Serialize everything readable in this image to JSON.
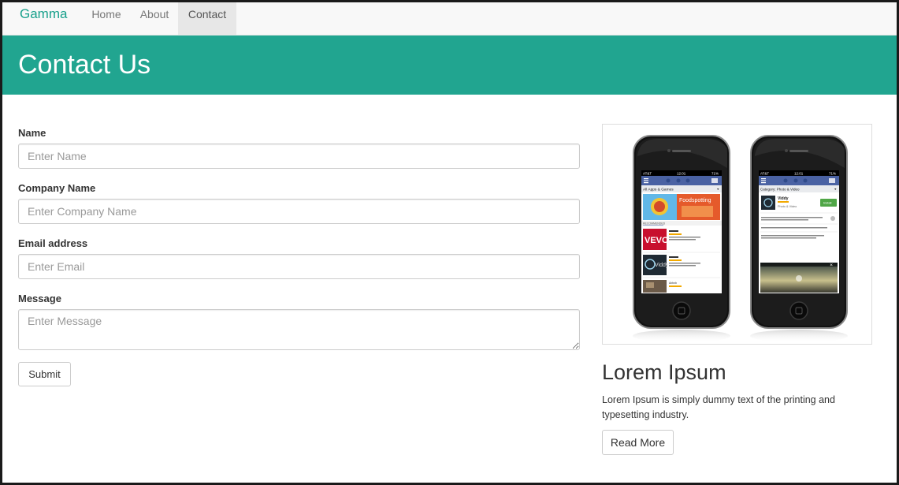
{
  "navbar": {
    "brand": "Gamma",
    "items": [
      {
        "label": "Home",
        "active": false
      },
      {
        "label": "About",
        "active": false
      },
      {
        "label": "Contact",
        "active": true
      }
    ]
  },
  "header": {
    "title": "Contact Us"
  },
  "form": {
    "name": {
      "label": "Name",
      "placeholder": "Enter Name",
      "value": ""
    },
    "company": {
      "label": "Company Name",
      "placeholder": "Enter Company Name",
      "value": ""
    },
    "email": {
      "label": "Email address",
      "placeholder": "Enter Email",
      "value": ""
    },
    "message": {
      "label": "Message",
      "placeholder": "Enter Message",
      "value": ""
    },
    "submit_label": "Submit"
  },
  "side": {
    "image": {
      "left_phone": {
        "carrier": "AT&T",
        "time": "12:01",
        "battery": "71%",
        "category": "All Apps & Games",
        "banner": "Foodspotting",
        "tab": "RECOMMENDED",
        "apps": [
          "VEVO",
          "Viddy",
          "Airbnb"
        ]
      },
      "right_phone": {
        "carrier": "AT&T",
        "time": "12:01",
        "battery": "71%",
        "category": "Category: Photo & Video",
        "app_name": "Viddy",
        "app_sub": "Photo & Video",
        "install_label": "Install"
      }
    },
    "title": "Lorem Ipsum",
    "text": "Lorem Ipsum is simply dummy text of the printing and typesetting industry.",
    "button_label": "Read More"
  },
  "colors": {
    "brand": "#18a08b",
    "header_bg": "#21a590",
    "navbar_bg": "#f8f8f8",
    "active_tab_bg": "#e7e7e7",
    "frame_border": "#1a1a1a"
  }
}
